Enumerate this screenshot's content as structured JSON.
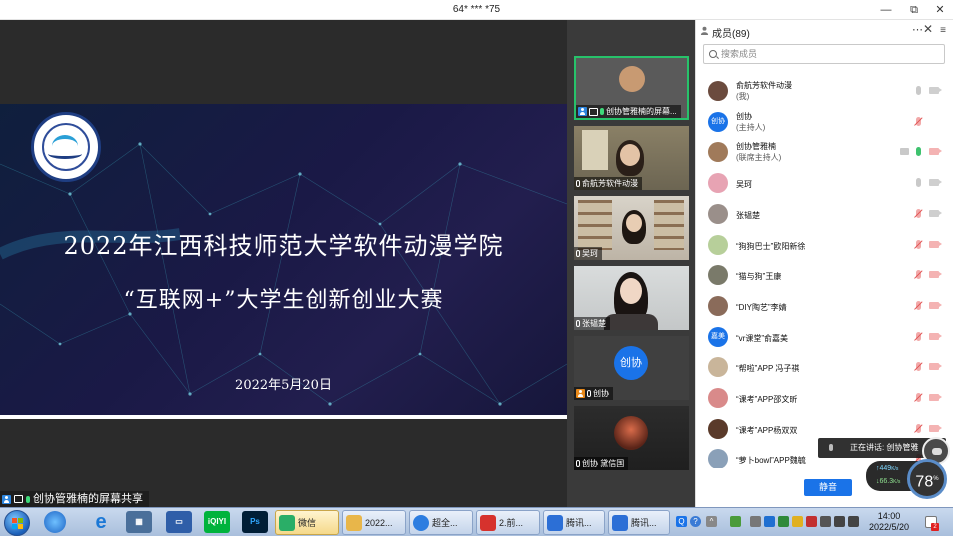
{
  "window": {
    "title": "64* *** *75"
  },
  "share": {
    "label": "创协管雅楠的屏幕共享",
    "slide": {
      "title_line1": "2022年江西科技师范大学软件动漫学院",
      "title_line2": "“互联网+”大学生创新创业大赛",
      "date": "2022年5月20日"
    }
  },
  "video_tiles": [
    {
      "name": "创协管雅楠的屏幕...",
      "active": true
    },
    {
      "name": "俞航芳软件动漫"
    },
    {
      "name": "吴珂"
    },
    {
      "name": "张韫楚"
    },
    {
      "name": "创协",
      "avatar_text": "创协"
    },
    {
      "name": "创协 黛信国"
    }
  ],
  "panel": {
    "title": "成员(89)",
    "search_placeholder": "搜索成员",
    "mute_all": "静音",
    "members": [
      {
        "name": "俞航芳软件动漫",
        "role": "(我)",
        "avatar_color": "#6b4b3e",
        "mic": "on",
        "cam": "off"
      },
      {
        "name": "创协",
        "role": "(主持人)",
        "avatar_text": "创协",
        "avatar_color": "#1a73e8",
        "mic": "muted",
        "cam": "none"
      },
      {
        "name": "创协管雅楠",
        "role": "(联席主持人)",
        "avatar_color": "#a07a5a",
        "mic": "green",
        "cam": "muted",
        "screen": true
      },
      {
        "name": "吴珂",
        "avatar_color": "#e7a3b3",
        "mic": "on",
        "cam": "off"
      },
      {
        "name": "张韫楚",
        "avatar_color": "#9a8f8a",
        "mic": "muted",
        "cam": "off"
      },
      {
        "name": "“狗狗巴士”欧阳新徐",
        "avatar_color": "#b7cf9a",
        "mic": "muted",
        "cam": "muted"
      },
      {
        "name": "“猫与狗”王康",
        "avatar_color": "#7a7a6a",
        "mic": "muted",
        "cam": "muted"
      },
      {
        "name": "“DIY陶艺”李婧",
        "avatar_color": "#8a6b5a",
        "mic": "muted",
        "cam": "muted"
      },
      {
        "name": "“vr课堂”俞嘉美",
        "avatar_text": "嘉美",
        "avatar_color": "#1a73e8",
        "mic": "muted",
        "cam": "muted"
      },
      {
        "name": "“帮啦”APP 冯子祺",
        "avatar_color": "#c9b59a",
        "mic": "muted",
        "cam": "muted"
      },
      {
        "name": "“课考”APP邵文昕",
        "avatar_color": "#d98a8a",
        "mic": "muted",
        "cam": "muted"
      },
      {
        "name": "“课考”APP杨双双",
        "avatar_color": "#5a3a2a",
        "mic": "muted",
        "cam": "muted"
      },
      {
        "name": "“萝卜bowl”APP魏毓",
        "avatar_color": "#8aa0b8",
        "mic": "muted",
        "cam": "muted"
      }
    ]
  },
  "speaking": {
    "text": "正在讲话: 创协管雅"
  },
  "network": {
    "up": "449",
    "down": "66.3",
    "unit": "K/s",
    "cpu": "78",
    "cpu_unit": "%"
  },
  "taskbar": {
    "apps": [
      {
        "label": "微信",
        "active": true,
        "color": "#2aae67"
      },
      {
        "label": "2022...",
        "color": "#e8b64a"
      },
      {
        "label": "超全...",
        "color": "#2c7de0"
      },
      {
        "label": "2.前...",
        "color": "#d6322d"
      },
      {
        "label": "腾讯...",
        "color": "#2c6fd6"
      },
      {
        "label": "腾讯...",
        "color": "#2c6fd6"
      }
    ],
    "clock_time": "14:00",
    "clock_date": "2022/5/20",
    "notify_count": "2"
  }
}
